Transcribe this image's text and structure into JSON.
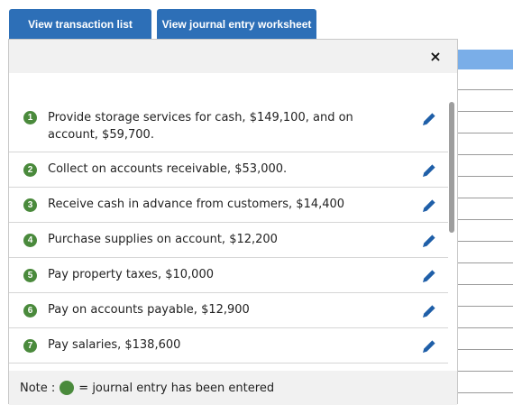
{
  "tabs": {
    "transaction_list": "View transaction list",
    "journal_worksheet": "View journal entry worksheet"
  },
  "panel": {
    "close_symbol": "×",
    "transactions": [
      {
        "number": "1",
        "text": "Provide storage services for cash, $149,100, and on account, $59,700."
      },
      {
        "number": "2",
        "text": "Collect on accounts receivable, $53,000."
      },
      {
        "number": "3",
        "text": "Receive cash in advance from customers, $14,400"
      },
      {
        "number": "4",
        "text": "Purchase supplies on account, $12,200"
      },
      {
        "number": "5",
        "text": "Pay property taxes, $10,000"
      },
      {
        "number": "6",
        "text": "Pay on accounts payable, $12,900"
      },
      {
        "number": "7",
        "text": "Pay salaries, $138,600"
      }
    ],
    "note_label": "Note :",
    "note_text": "= journal entry has been entered"
  },
  "colors": {
    "tab_blue": "#2d6fb7",
    "entered_green": "#4a8a3c",
    "edit_icon_blue": "#1f5fa8",
    "worksheet_header_blue": "#7aaee8"
  }
}
